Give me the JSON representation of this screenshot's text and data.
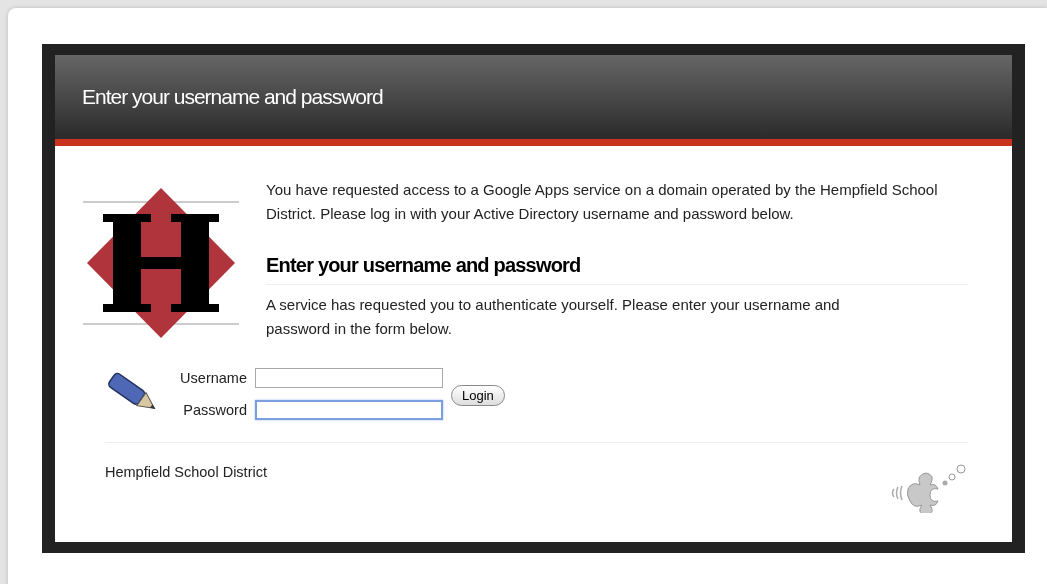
{
  "header": {
    "title": "Enter your username and password"
  },
  "intro": "You have requested access to a Google Apps service on a domain operated by the Hempfield School District. Please log in with your Active Directory username and password below.",
  "section": {
    "title": "Enter your username and password",
    "text": "A service has requested you to authenticate yourself. Please enter your username and password in the form below."
  },
  "form": {
    "fields": [
      {
        "label": "Username",
        "focused": false
      },
      {
        "label": "Password",
        "focused": true
      }
    ],
    "button": "Login"
  },
  "footer": {
    "text": "Hempfield School District"
  }
}
